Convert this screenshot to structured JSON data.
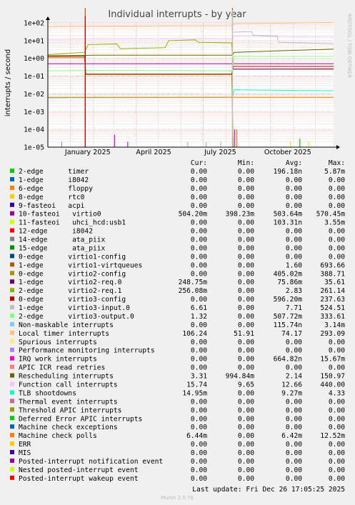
{
  "chart_data": {
    "type": "line",
    "title": "Individual interrupts - by year",
    "ylabel": "interrupts / second",
    "y_scale": "log",
    "ylim": [
      1e-05,
      100
    ],
    "y_ticks": [
      "1e+02",
      "1e+01",
      "1e+00",
      "1e-01",
      "1e-02",
      "1e-03",
      "1e-04",
      "1e-05"
    ],
    "y_tick_values": [
      100,
      10,
      1,
      0.1,
      0.01,
      0.001,
      0.0001,
      1e-05
    ],
    "x_ticks": [
      "January 2025",
      "April 2025",
      "July 2025",
      "October 2025"
    ],
    "x_tick_dates": [
      "2025-01-01",
      "2025-04-01",
      "2025-07-01",
      "2025-10-01"
    ],
    "x_range": [
      "2024-12-01",
      "2025-12-26"
    ],
    "grid": true,
    "side_label": "RRDTOOL / TOBI OETIKER",
    "legend_header": [
      "Cur:",
      "Min:",
      "Avg:",
      "Max:"
    ],
    "series": [
      {
        "name": "2-edge      timer",
        "color": "#00cc00",
        "cur": "0.00",
        "min": "0.00",
        "avg": "196.18n",
        "max": "5.87m"
      },
      {
        "name": "1-edge      i8042",
        "color": "#0066b3",
        "cur": "0.00",
        "min": "0.00",
        "avg": "0.00",
        "max": "0.00"
      },
      {
        "name": "6-edge      floppy",
        "color": "#ff8000",
        "cur": "0.00",
        "min": "0.00",
        "avg": "0.00",
        "max": "0.00"
      },
      {
        "name": "8-edge      rtc0",
        "color": "#ffcc00",
        "cur": "0.00",
        "min": "0.00",
        "avg": "0.00",
        "max": "0.00"
      },
      {
        "name": "9-fasteoi   acpi",
        "color": "#330099",
        "cur": "0.00",
        "min": "0.00",
        "avg": "0.00",
        "max": "0.00"
      },
      {
        "name": "10-fasteoi   virtio0",
        "color": "#990099",
        "cur": "504.20m",
        "min": "398.23m",
        "avg": "503.64m",
        "max": "570.45m"
      },
      {
        "name": "11-fasteoi   uhci_hcd:usb1",
        "color": "#ccff00",
        "cur": "0.00",
        "min": "0.00",
        "avg": "103.31n",
        "max": "3.55m"
      },
      {
        "name": "12-edge      i8042",
        "color": "#ff0000",
        "cur": "0.00",
        "min": "0.00",
        "avg": "0.00",
        "max": "0.00"
      },
      {
        "name": "14-edge      ata_piix",
        "color": "#808080",
        "cur": "0.00",
        "min": "0.00",
        "avg": "0.00",
        "max": "0.00"
      },
      {
        "name": "15-edge      ata_piix",
        "color": "#008f00",
        "cur": "0.00",
        "min": "0.00",
        "avg": "0.00",
        "max": "0.00"
      },
      {
        "name": "0-edge      virtio1-config",
        "color": "#00487d",
        "cur": "0.00",
        "min": "0.00",
        "avg": "0.00",
        "max": "0.00"
      },
      {
        "name": "1-edge      virtio1-virtqueues",
        "color": "#b35a00",
        "cur": "0.00",
        "min": "0.00",
        "avg": "1.60",
        "max": "693.66"
      },
      {
        "name": "0-edge      virtio2-config",
        "color": "#b38f00",
        "cur": "0.00",
        "min": "0.00",
        "avg": "405.02m",
        "max": "388.71"
      },
      {
        "name": "1-edge      virtio2-req.0",
        "color": "#6b006b",
        "cur": "248.75m",
        "min": "0.00",
        "avg": "75.86m",
        "max": "35.61"
      },
      {
        "name": "2-edge      virtio2-req.1",
        "color": "#8fb300",
        "cur": "256.08m",
        "min": "0.00",
        "avg": "2.83",
        "max": "261.14"
      },
      {
        "name": "0-edge      virtio3-config",
        "color": "#b30000",
        "cur": "0.00",
        "min": "0.00",
        "avg": "596.20m",
        "max": "237.63"
      },
      {
        "name": "1-edge      virtio3-input.0",
        "color": "#bebebe",
        "cur": "6.61",
        "min": "0.00",
        "avg": "7.71",
        "max": "524.51"
      },
      {
        "name": "2-edge      virtio3-output.0",
        "color": "#80ff80",
        "cur": "1.32",
        "min": "0.00",
        "avg": "507.72m",
        "max": "333.61"
      },
      {
        "name": "Non-maskable interrupts",
        "color": "#80c9ff",
        "cur": "0.00",
        "min": "0.00",
        "avg": "115.74n",
        "max": "3.14m"
      },
      {
        "name": "Local timer interrupts",
        "color": "#ffc080",
        "cur": "106.24",
        "min": "51.91",
        "avg": "74.17",
        "max": "293.09"
      },
      {
        "name": "Spurious interrupts",
        "color": "#ffe680",
        "cur": "0.00",
        "min": "0.00",
        "avg": "0.00",
        "max": "0.00"
      },
      {
        "name": "Performance monitoring interrupts",
        "color": "#aa80ff",
        "cur": "0.00",
        "min": "0.00",
        "avg": "0.00",
        "max": "0.00"
      },
      {
        "name": "IRQ work interrupts",
        "color": "#ee00cc",
        "cur": "0.00",
        "min": "0.00",
        "avg": "664.82n",
        "max": "15.67m"
      },
      {
        "name": "APIC ICR read retries",
        "color": "#ff8080",
        "cur": "0.00",
        "min": "0.00",
        "avg": "0.00",
        "max": "0.00"
      },
      {
        "name": "Rescheduling interrupts",
        "color": "#666600",
        "cur": "3.31",
        "min": "994.84m",
        "avg": "2.14",
        "max": "150.97"
      },
      {
        "name": "Function call interrupts",
        "color": "#ffbfff",
        "cur": "15.74",
        "min": "9.65",
        "avg": "12.66",
        "max": "440.00"
      },
      {
        "name": "TLB shootdowns",
        "color": "#00ffcc",
        "cur": "14.95m",
        "min": "0.00",
        "avg": "9.27m",
        "max": "4.33"
      },
      {
        "name": "Thermal event interrupts",
        "color": "#cc6699",
        "cur": "0.00",
        "min": "0.00",
        "avg": "0.00",
        "max": "0.00"
      },
      {
        "name": "Threshold APIC interrupts",
        "color": "#999900",
        "cur": "0.00",
        "min": "0.00",
        "avg": "0.00",
        "max": "0.00"
      },
      {
        "name": "Deferred Error APIC interrupts",
        "color": "#00cc00",
        "cur": "0.00",
        "min": "0.00",
        "avg": "0.00",
        "max": "0.00"
      },
      {
        "name": "Machine check exceptions",
        "color": "#0066b3",
        "cur": "0.00",
        "min": "0.00",
        "avg": "0.00",
        "max": "0.00"
      },
      {
        "name": "Machine check polls",
        "color": "#ff8000",
        "cur": "6.44m",
        "min": "0.00",
        "avg": "6.42m",
        "max": "12.52m"
      },
      {
        "name": "ERR",
        "color": "#ffcc00",
        "cur": "0.00",
        "min": "0.00",
        "avg": "0.00",
        "max": "0.00"
      },
      {
        "name": "MIS",
        "color": "#330099",
        "cur": "0.00",
        "min": "0.00",
        "avg": "0.00",
        "max": "0.00"
      },
      {
        "name": "Posted-interrupt notification event",
        "color": "#990099",
        "cur": "0.00",
        "min": "0.00",
        "avg": "0.00",
        "max": "0.00"
      },
      {
        "name": "Nested posted-interrupt event",
        "color": "#ccff00",
        "cur": "0.00",
        "min": "0.00",
        "avg": "0.00",
        "max": "0.00"
      },
      {
        "name": "Posted-interrupt wakeup event",
        "color": "#ff0000",
        "cur": "0.00",
        "min": "0.00",
        "avg": "0.00",
        "max": "0.00"
      }
    ],
    "plot_lines": [
      {
        "series": "Local timer interrupts",
        "color": "#ffc080",
        "points": [
          [
            "2024-12-01",
            62
          ],
          [
            "2025-01-20",
            64
          ],
          [
            "2025-03-01",
            66
          ],
          [
            "2025-05-01",
            68
          ],
          [
            "2025-08-10",
            70
          ],
          [
            "2025-08-12",
            90
          ],
          [
            "2025-10-01",
            95
          ],
          [
            "2025-12-26",
            106
          ]
        ]
      },
      {
        "series": "Function call interrupts",
        "color": "#ffbfff",
        "points": [
          [
            "2024-12-01",
            12
          ],
          [
            "2025-04-01",
            12.5
          ],
          [
            "2025-08-10",
            12.5
          ],
          [
            "2025-08-12",
            18
          ],
          [
            "2025-12-26",
            15.7
          ]
        ]
      },
      {
        "series": "2-edge      virtio2-req.1",
        "color": "#8fb300",
        "points": [
          [
            "2024-12-01",
            1.6
          ],
          [
            "2025-01-20",
            2.2
          ],
          [
            "2025-01-25",
            6
          ],
          [
            "2025-03-05",
            6.5
          ],
          [
            "2025-03-10",
            3.5
          ],
          [
            "2025-05-10",
            4
          ],
          [
            "2025-05-15",
            10
          ],
          [
            "2025-06-20",
            11
          ],
          [
            "2025-06-25",
            8
          ],
          [
            "2025-08-09",
            7.5
          ],
          [
            "2025-08-11",
            0.25
          ],
          [
            "2025-12-26",
            0.26
          ]
        ]
      },
      {
        "series": "Rescheduling interrupts",
        "color": "#666600",
        "points": [
          [
            "2024-12-01",
            1.4
          ],
          [
            "2025-02-01",
            1.5
          ],
          [
            "2025-05-01",
            1.5
          ],
          [
            "2025-08-10",
            1.5
          ],
          [
            "2025-08-12",
            2.2
          ],
          [
            "2025-12-26",
            3.3
          ]
        ]
      },
      {
        "series": "0-edge      virtio3-config",
        "color": "#b30000",
        "points": [
          [
            "2024-12-01",
            1.3
          ],
          [
            "2025-01-20",
            1.3
          ],
          [
            "2025-01-22",
            0.13
          ],
          [
            "2025-08-09",
            0.13
          ],
          [
            "2025-08-11",
            0.35
          ],
          [
            "2025-12-26",
            0.35
          ]
        ]
      },
      {
        "series": "0-edge      virtio2-config",
        "color": "#b38f00",
        "points": [
          [
            "2024-12-01",
            1.1
          ],
          [
            "2025-01-20",
            1.1
          ],
          [
            "2025-01-22",
            0.12
          ],
          [
            "2025-08-09",
            0.12
          ],
          [
            "2025-08-11",
            0.0
          ],
          [
            "2025-12-26",
            0.0
          ]
        ]
      },
      {
        "series": "10-fasteoi   virtio0",
        "color": "#990099",
        "points": [
          [
            "2024-12-01",
            0.5
          ],
          [
            "2025-12-26",
            0.5
          ]
        ]
      },
      {
        "series": "2-edge      virtio3-output.0",
        "color": "#80ff80",
        "points": [
          [
            "2024-12-01",
            0.2
          ],
          [
            "2025-03-01",
            0.21
          ],
          [
            "2025-08-10",
            0.2
          ],
          [
            "2025-08-12",
            1.3
          ],
          [
            "2025-12-26",
            1.32
          ]
        ]
      },
      {
        "series": "1-edge      virtio3-input.0",
        "color": "#bebebe",
        "points": [
          [
            "2025-08-11",
            30
          ],
          [
            "2025-09-05",
            32
          ],
          [
            "2025-09-07",
            20
          ],
          [
            "2025-10-10",
            18
          ],
          [
            "2025-10-12",
            8
          ],
          [
            "2025-12-26",
            6.6
          ]
        ]
      },
      {
        "series": "1-edge      virtio2-req.0",
        "color": "#6b006b",
        "points": [
          [
            "2025-08-11",
            0.25
          ],
          [
            "2025-12-26",
            0.25
          ]
        ]
      },
      {
        "series": "TLB shootdowns",
        "color": "#00ffcc",
        "points": [
          [
            "2024-12-01",
            0.006
          ],
          [
            "2025-08-10",
            0.0065
          ],
          [
            "2025-08-12",
            0.017
          ],
          [
            "2025-12-26",
            0.015
          ]
        ]
      },
      {
        "series": "Machine check polls",
        "color": "#ff8000",
        "points": [
          [
            "2024-12-01",
            0.0064
          ],
          [
            "2025-12-26",
            0.0064
          ]
        ]
      }
    ],
    "spikes": [
      {
        "series": "Performance monitoring interrupts",
        "color": "#aa80ff",
        "date": "2024-12-20",
        "value": 2e-05
      },
      {
        "series": "IRQ work interrupts",
        "color": "#ee00cc",
        "date": "2025-03-02",
        "value": 5e-05
      },
      {
        "series": "IRQ work interrupts",
        "color": "#ee00cc",
        "date": "2025-03-20",
        "value": 2e-05
      },
      {
        "series": "1-edge      virtio1-virtqueues",
        "color": "#b35a00",
        "date": "2025-01-21",
        "value": 690
      },
      {
        "series": "0-edge      virtio3-config",
        "color": "#b30000",
        "date": "2025-01-21",
        "value": 237
      },
      {
        "series": "1-edge      virtio1-virtqueues",
        "color": "#b35a00",
        "date": "2025-08-10",
        "value": 690
      },
      {
        "series": "1-edge      virtio3-input.0",
        "color": "#bebebe",
        "date": "2025-08-10",
        "value": 524
      },
      {
        "series": "IRQ work interrupts",
        "color": "#ee00cc",
        "date": "2025-08-13",
        "value": 0.0001
      },
      {
        "series": "Machine check polls",
        "color": "#ff8000",
        "date": "2025-08-16",
        "value": 0.0001
      },
      {
        "series": "Non-maskable interrupts",
        "color": "#80c9ff",
        "date": "2025-06-10",
        "value": 2e-05
      },
      {
        "series": "Non-maskable interrupts",
        "color": "#80c9ff",
        "date": "2025-07-05",
        "value": 2e-05
      },
      {
        "series": "Non-maskable interrupts",
        "color": "#80c9ff",
        "date": "2025-07-25",
        "value": 2e-05
      },
      {
        "series": "2-edge      timer",
        "color": "#00cc00",
        "date": "2025-11-10",
        "value": 3e-05
      },
      {
        "series": "11-fasteoi   uhci_hcd:usb1",
        "color": "#ccff00",
        "date": "2025-10-28",
        "value": 2e-05
      },
      {
        "series": "11-fasteoi   uhci_hcd:usb1",
        "color": "#ccff00",
        "date": "2025-11-22",
        "value": 2e-05
      }
    ],
    "last_update": "Last update: Fri Dec 26 17:05:25 2025",
    "footer": "Munin 2.0.76"
  }
}
